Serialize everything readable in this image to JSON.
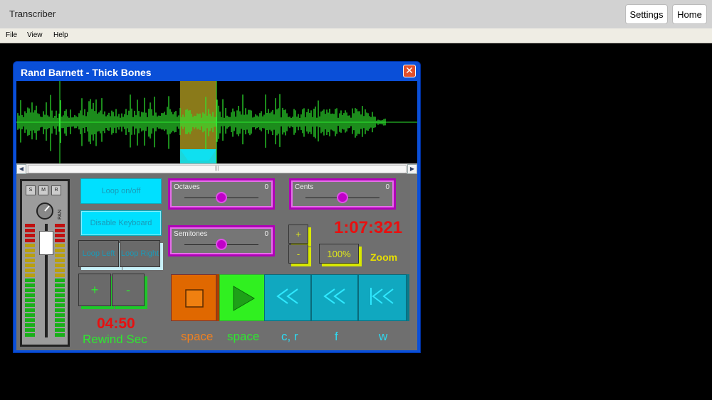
{
  "app": {
    "title": "Transcriber",
    "settings_label": "Settings",
    "home_label": "Home"
  },
  "menu": [
    "File",
    "View",
    "Help"
  ],
  "window": {
    "title": "Rand Barnett - Thick Bones",
    "close_glyph": "✕"
  },
  "mixer": {
    "solo": "S",
    "mute": "M",
    "record": "R",
    "pan_label": "PAN"
  },
  "loop": {
    "toggle": "Loop on/off",
    "disable_keyboard": "Disable Keyboard",
    "left": "Loop Left",
    "right": "Loop Right"
  },
  "rewind": {
    "plus": "+",
    "minus": "-",
    "time": "04:50",
    "label": "Rewind Sec"
  },
  "octaves": {
    "label": "Octaves",
    "value": "0",
    "level": 0.5
  },
  "cents": {
    "label": "Cents",
    "value": "0",
    "level": 0.5
  },
  "semitones": {
    "label": "Semitones",
    "value": "0",
    "level": 0.5
  },
  "zoom": {
    "plus": "+",
    "minus": "-",
    "percent": "100%",
    "label": "Zoom"
  },
  "position_time": "1:07:321",
  "transport": {
    "stop_key": "space",
    "play_key": "space",
    "back_fast_key": "c, r",
    "back_key": "f",
    "start_key": "w"
  },
  "colors": {
    "waveform": "#2ee830",
    "selection": "#8a7a1a",
    "time": "#e81010",
    "accent_cyan": "#00e0ff",
    "slider": "#c000c8"
  }
}
